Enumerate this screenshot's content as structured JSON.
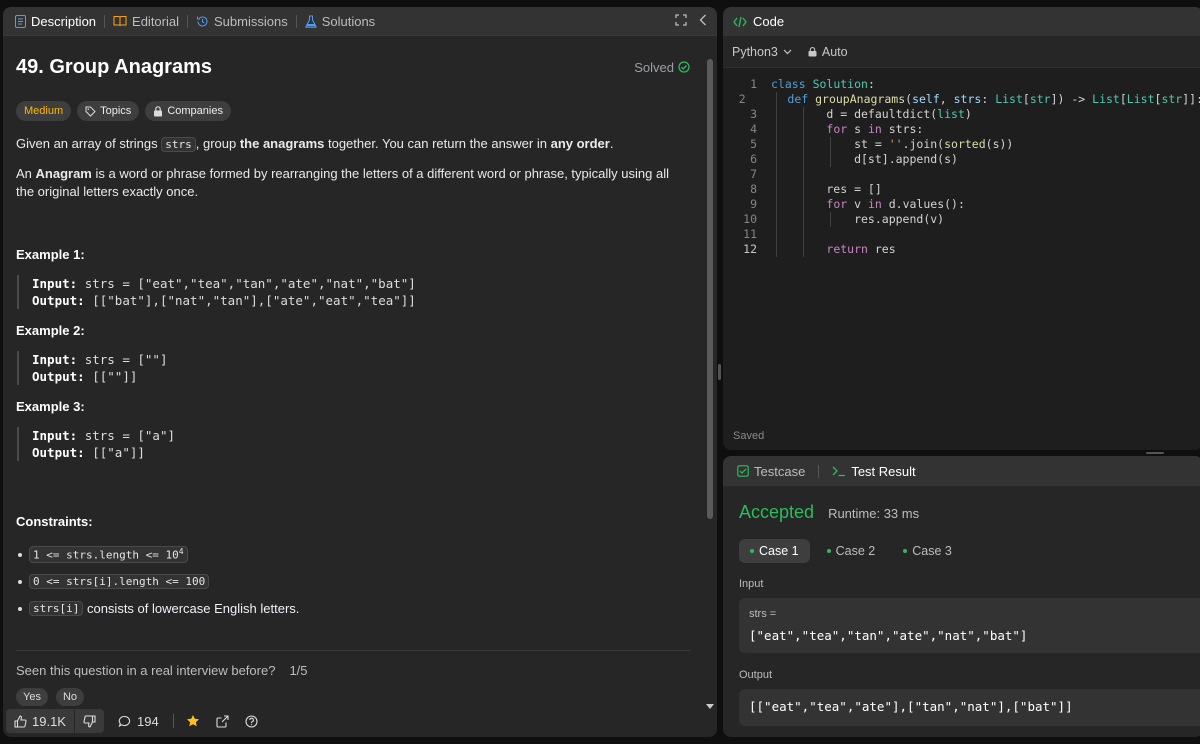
{
  "left_tabs": [
    {
      "label": "Description",
      "icon": "document-icon",
      "color": "#4a9eff"
    },
    {
      "label": "Editorial",
      "icon": "book-icon",
      "color": "#ffa116"
    },
    {
      "label": "Submissions",
      "icon": "history-icon",
      "color": "#4a9eff"
    },
    {
      "label": "Solutions",
      "icon": "flask-icon",
      "color": "#4a9eff"
    }
  ],
  "problem": {
    "title": "49. Group Anagrams",
    "status": "Solved",
    "difficulty": "Medium",
    "topics_label": "Topics",
    "companies_label": "Companies",
    "desc1": {
      "before": "Given an array of strings ",
      "code": "strs",
      "mid": ", group ",
      "bold1": "the anagrams",
      "mid2": " together. You can return the answer in ",
      "bold2": "any order",
      "after": "."
    },
    "desc2": {
      "before": "An ",
      "bold": "Anagram",
      "after": " is a word or phrase formed by rearranging the letters of a different word or phrase, typically using all the original letters exactly once."
    },
    "examples": [
      {
        "title": "Example 1:",
        "input_label": "Input:",
        "input": "strs = [\"eat\",\"tea\",\"tan\",\"ate\",\"nat\",\"bat\"]",
        "output_label": "Output:",
        "output": "[[\"bat\"],[\"nat\",\"tan\"],[\"ate\",\"eat\",\"tea\"]]"
      },
      {
        "title": "Example 2:",
        "input_label": "Input:",
        "input": "strs = [\"\"]",
        "output_label": "Output:",
        "output": "[[\"\"]]"
      },
      {
        "title": "Example 3:",
        "input_label": "Input:",
        "input": "strs = [\"a\"]",
        "output_label": "Output:",
        "output": "[[\"a\"]]"
      }
    ],
    "constraints_title": "Constraints:",
    "constraints": [
      {
        "code": "1 <= strs.length <= 10",
        "sup": "4",
        "text": ""
      },
      {
        "code": "0 <= strs[i].length <= 100",
        "sup": "",
        "text": ""
      },
      {
        "code": "strs[i]",
        "sup": "",
        "text": " consists of lowercase English letters."
      }
    ],
    "interview_question": "Seen this question in a real interview before?",
    "interview_count": "1/5",
    "yes_label": "Yes",
    "no_label": "No",
    "likes": "19.1K",
    "comments": "194"
  },
  "code_panel": {
    "title": "Code",
    "language": "Python3",
    "mode": "Auto",
    "saved": "Saved",
    "lines": [
      {
        "n": "1",
        "html": "<span class=\"kw\">class</span> <span class=\"ty\">Solution</span>:"
      },
      {
        "n": "2",
        "html": "    <span class=\"kw\">def</span> <span class=\"fn\">groupAnagrams</span>(<span class=\"pm\">self</span>, <span class=\"pm\">strs</span>: <span class=\"ty\">List</span>[<span class=\"ty\">str</span>]) -> <span class=\"ty\">List</span>[<span class=\"ty\">List</span>[<span class=\"ty\">str</span>]]:"
      },
      {
        "n": "3",
        "html": "        d = defaultdict(<span class=\"ty\">list</span>)"
      },
      {
        "n": "4",
        "html": "        <span class=\"kw2\">for</span> s <span class=\"kw2\">in</span> strs:"
      },
      {
        "n": "5",
        "html": "            st = <span class=\"st\">''</span>.join(<span class=\"fn\">sorted</span>(s))"
      },
      {
        "n": "6",
        "html": "            d[st].append(s)"
      },
      {
        "n": "7",
        "html": ""
      },
      {
        "n": "8",
        "html": "        res = []"
      },
      {
        "n": "9",
        "html": "        <span class=\"kw2\">for</span> v <span class=\"kw2\">in</span> d.values():"
      },
      {
        "n": "10",
        "html": "            res.append(v)"
      },
      {
        "n": "11",
        "html": ""
      },
      {
        "n": "12",
        "html": "        <span class=\"kw2\">return</span> res"
      }
    ]
  },
  "result_panel": {
    "testcase_label": "Testcase",
    "result_label": "Test Result",
    "status": "Accepted",
    "runtime": "Runtime: 33 ms",
    "cases": [
      "Case 1",
      "Case 2",
      "Case 3"
    ],
    "input_label": "Input",
    "input_name": "strs =",
    "input_value": "[\"eat\",\"tea\",\"tan\",\"ate\",\"nat\",\"bat\"]",
    "output_label": "Output",
    "output_value": "[[\"eat\",\"tea\",\"ate\"],[\"tan\",\"nat\"],[\"bat\"]]"
  }
}
